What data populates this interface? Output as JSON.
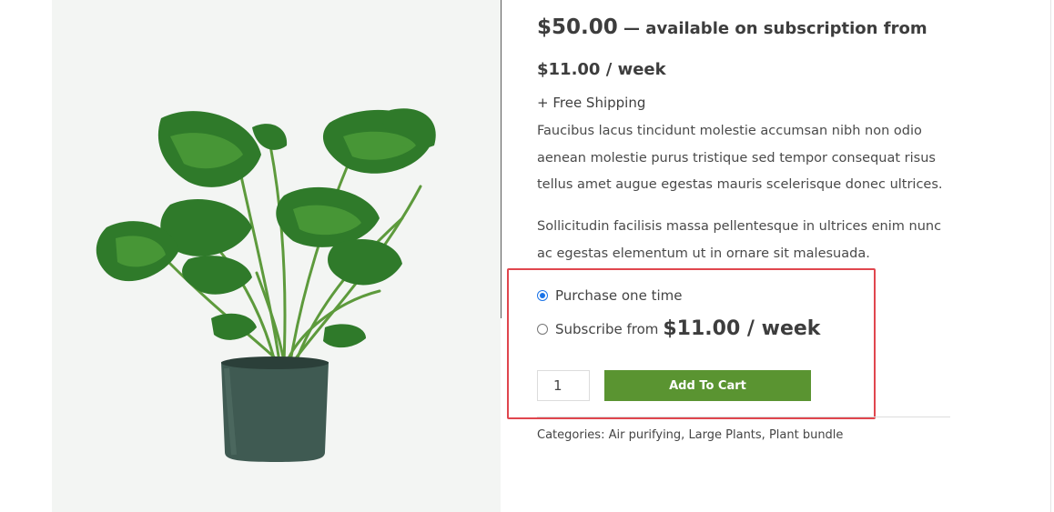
{
  "product": {
    "price": "$50.00",
    "subscription_text": " — available on subscription from $11.00 / week",
    "shipping": "+ Free Shipping",
    "description_1": "Faucibus lacus tincidunt molestie accumsan nibh non odio aenean molestie purus tristique sed tempor consequat risus tellus amet augue egestas mauris scelerisque donec ultrices.",
    "description_2": "Sollicitudin facilisis massa pellentesque in ultrices enim nunc ac egestas elementum ut in ornare sit malesuada."
  },
  "purchase_options": {
    "one_time_label": "Purchase one time",
    "subscribe_label": "Subscribe from",
    "subscribe_price": "$11.00 / week",
    "selected": "one_time"
  },
  "cart": {
    "quantity": "1",
    "add_button_label": "Add To Cart"
  },
  "categories": {
    "label": "Categories:",
    "items": [
      "Air purifying",
      "Large Plants",
      "Plant bundle"
    ]
  },
  "image": {
    "icon": "monstera-plant-image"
  },
  "colors": {
    "accent_green": "#5a9431",
    "highlight_red": "#e0464e",
    "radio_blue": "#1a73e8"
  }
}
